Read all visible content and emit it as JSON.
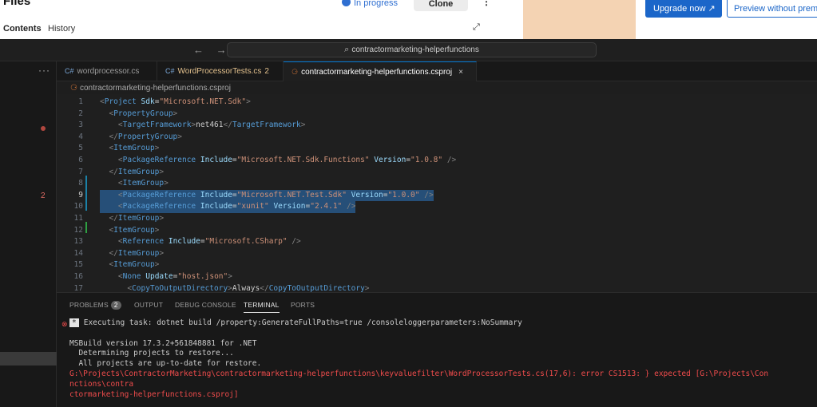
{
  "web": {
    "files_title": "Files",
    "tab_contents": "Contents",
    "tab_history": "History",
    "status": "In progress",
    "clone_label": "Clone",
    "more": "⋮",
    "expand": "⤢",
    "upgrade_label": "Upgrade now ↗",
    "preview_label": "Preview without premiu"
  },
  "titlebar": {
    "nav": "← →",
    "search_icon": "⌕",
    "search_text": "contractormarketing-helperfunctions"
  },
  "sidebar": {
    "more": "···",
    "problem_count": "2"
  },
  "tabs": [
    {
      "icon": "C#",
      "label": "wordprocessor.cs"
    },
    {
      "icon": "C#",
      "label": "WordProcessorTests.cs",
      "count": "2"
    },
    {
      "icon": "⚆",
      "label": "contractormarketing-helperfunctions.csproj",
      "close": "×"
    }
  ],
  "breadcrumb": {
    "icon": "⚆",
    "file": "contractormarketing-helperfunctions.csproj"
  },
  "editor": {
    "lines": [
      {
        "n": "1",
        "text": "<Project Sdk=\"Microsoft.NET.Sdk\">"
      },
      {
        "n": "2",
        "text": "  <PropertyGroup>"
      },
      {
        "n": "3",
        "text": "    <TargetFramework>net461</TargetFramework>"
      },
      {
        "n": "4",
        "text": "  </PropertyGroup>"
      },
      {
        "n": "5",
        "text": "  <ItemGroup>"
      },
      {
        "n": "6",
        "text": "    <PackageReference Include=\"Microsoft.NET.Sdk.Functions\" Version=\"1.0.8\" />"
      },
      {
        "n": "7",
        "text": "  </ItemGroup>"
      },
      {
        "n": "8",
        "text": "    <ItemGroup>"
      },
      {
        "n": "9",
        "text": "    <PackageReference Include=\"Microsoft.NET.Test.Sdk\" Version=\"1.0.0\" />"
      },
      {
        "n": "10",
        "text": "    <PackageReference Include=\"xunit\" Version=\"2.4.1\" />"
      },
      {
        "n": "11",
        "text": "  </ItemGroup>"
      },
      {
        "n": "12",
        "text": "  <ItemGroup>"
      },
      {
        "n": "13",
        "text": "    <Reference Include=\"Microsoft.CSharp\" />"
      },
      {
        "n": "14",
        "text": "  </ItemGroup>"
      },
      {
        "n": "15",
        "text": "  <ItemGroup>"
      },
      {
        "n": "16",
        "text": "    <None Update=\"host.json\">"
      },
      {
        "n": "17",
        "text": "      <CopyToOutputDirectory>Always</CopyToOutputDirectory>"
      }
    ]
  },
  "panel": {
    "tabs": [
      "PROBLEMS",
      "OUTPUT",
      "DEBUG CONSOLE",
      "TERMINAL",
      "PORTS"
    ],
    "problems_count": "2",
    "active_tab": "TERMINAL"
  },
  "terminal": {
    "task_marker": "*",
    "task_line": "Executing task: dotnet build /property:GenerateFullPaths=true /consoleloggerparameters:NoSummary",
    "msbuild": "MSBuild version 17.3.2+561848881 for .NET",
    "determining": "  Determining projects to restore...",
    "uptodate": "  All projects are up-to-date for restore.",
    "error_1": "G:\\Projects\\ContractorMarketing\\contractormarketing-helperfunctions\\keyvaluefilter\\WordProcessorTests.cs(17,6): error CS1513: } expected [G:\\Projects\\Con",
    "error_2": "nctions\\contra",
    "error_3": "ctormarketing-helperfunctions.csproj]"
  },
  "colors": {
    "accent": "#0078d4",
    "error": "#f14c4c",
    "selection": "#264f78"
  }
}
